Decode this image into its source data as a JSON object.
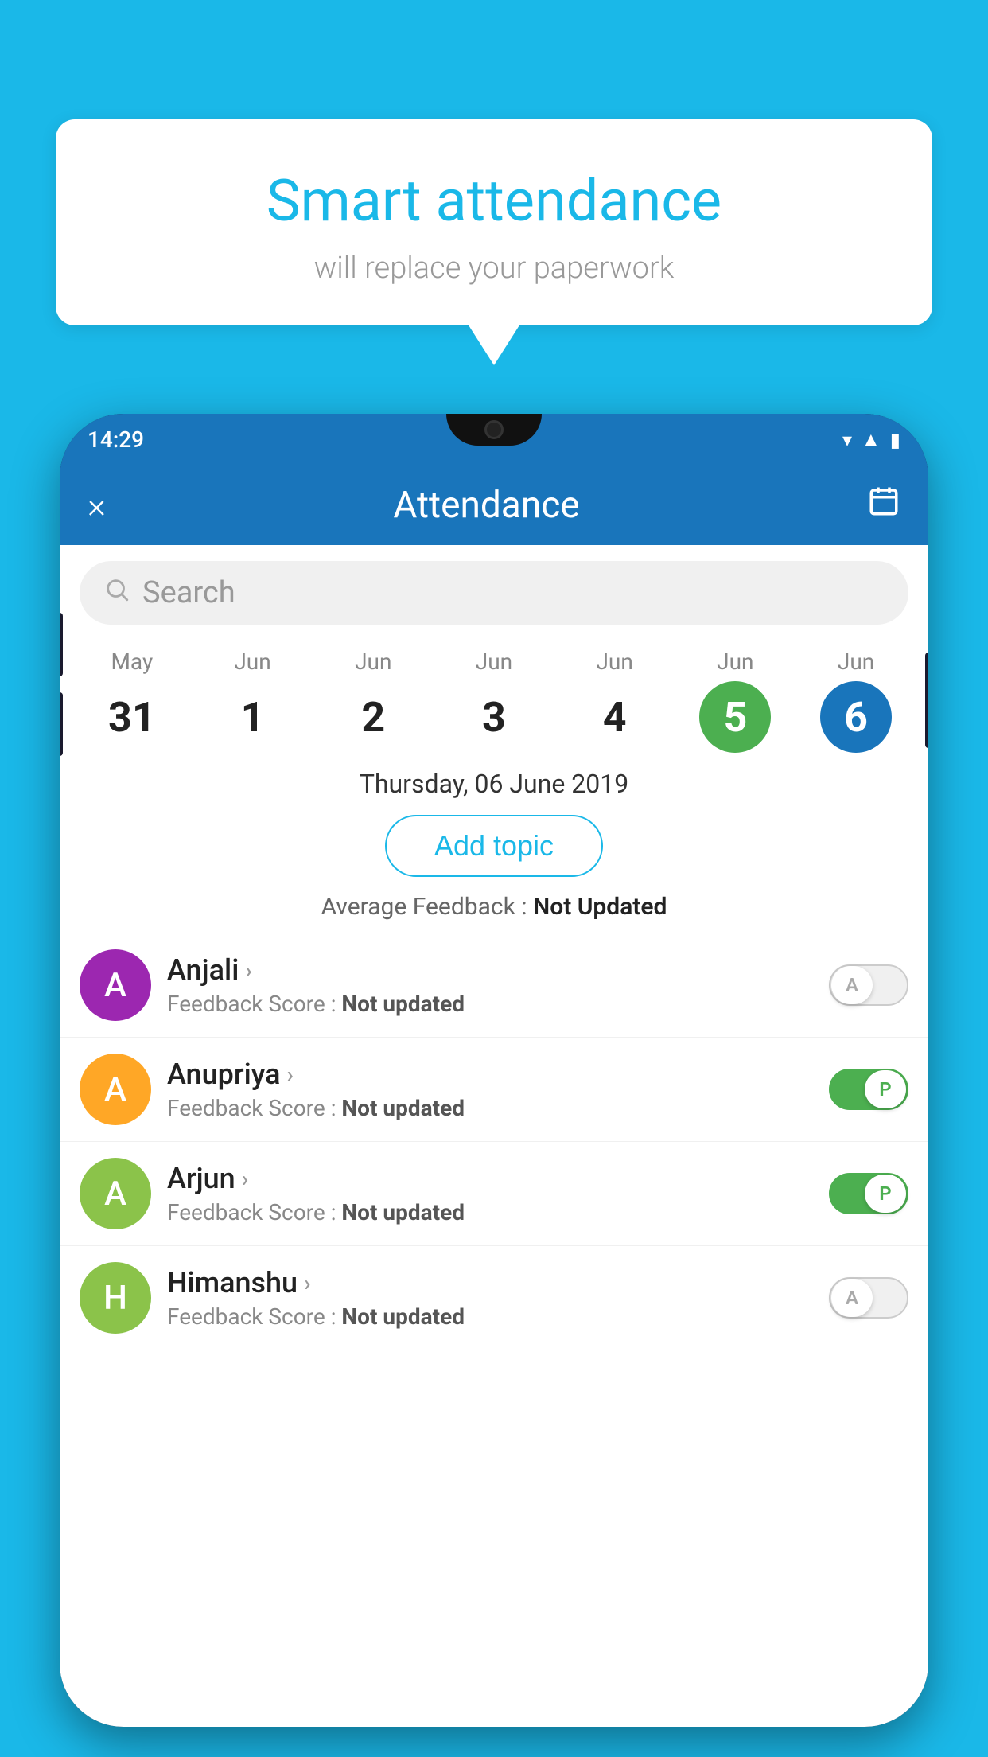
{
  "background_color": "#1ab8e8",
  "speech_bubble": {
    "title": "Smart attendance",
    "subtitle": "will replace your paperwork"
  },
  "status_bar": {
    "time": "14:29",
    "icons": [
      "wifi",
      "signal",
      "battery"
    ]
  },
  "app_header": {
    "close_label": "×",
    "title": "Attendance",
    "calendar_icon": "📅"
  },
  "search": {
    "placeholder": "Search"
  },
  "calendar": {
    "days": [
      {
        "month": "May",
        "date": "31",
        "state": "normal"
      },
      {
        "month": "Jun",
        "date": "1",
        "state": "normal"
      },
      {
        "month": "Jun",
        "date": "2",
        "state": "normal"
      },
      {
        "month": "Jun",
        "date": "3",
        "state": "normal"
      },
      {
        "month": "Jun",
        "date": "4",
        "state": "normal"
      },
      {
        "month": "Jun",
        "date": "5",
        "state": "today"
      },
      {
        "month": "Jun",
        "date": "6",
        "state": "selected"
      }
    ]
  },
  "selected_date_label": "Thursday, 06 June 2019",
  "add_topic_label": "Add topic",
  "avg_feedback_prefix": "Average Feedback : ",
  "avg_feedback_value": "Not Updated",
  "students": [
    {
      "name": "Anjali",
      "avatar_letter": "A",
      "avatar_color": "#9c27b0",
      "feedback_label": "Feedback Score : ",
      "feedback_value": "Not updated",
      "attendance": "absent",
      "toggle_label": "A"
    },
    {
      "name": "Anupriya",
      "avatar_letter": "A",
      "avatar_color": "#ffa726",
      "feedback_label": "Feedback Score : ",
      "feedback_value": "Not updated",
      "attendance": "present",
      "toggle_label": "P"
    },
    {
      "name": "Arjun",
      "avatar_letter": "A",
      "avatar_color": "#8bc34a",
      "feedback_label": "Feedback Score : ",
      "feedback_value": "Not updated",
      "attendance": "present",
      "toggle_label": "P"
    },
    {
      "name": "Himanshu",
      "avatar_letter": "H",
      "avatar_color": "#8bc34a",
      "feedback_label": "Feedback Score : ",
      "feedback_value": "Not updated",
      "attendance": "absent",
      "toggle_label": "A"
    }
  ]
}
